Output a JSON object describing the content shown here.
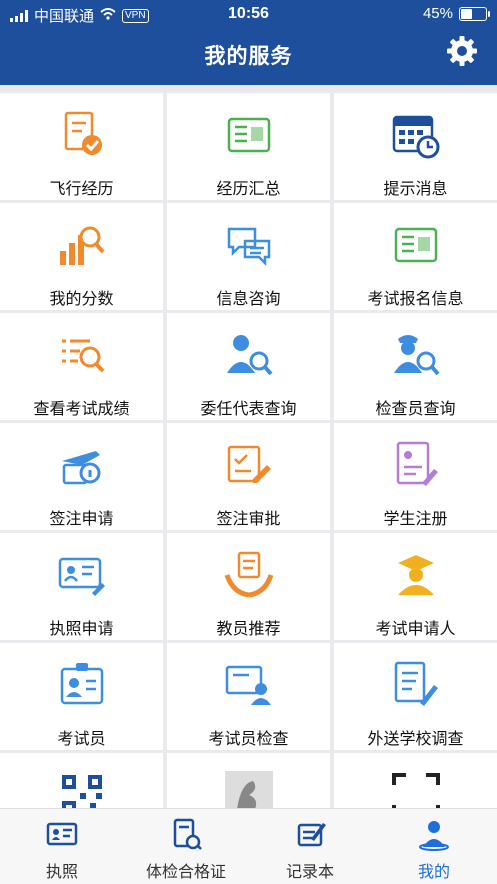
{
  "status_bar": {
    "carrier": "中国联通",
    "vpn": "VPN",
    "time": "10:56",
    "battery": "45%",
    "battery_level": 0.45
  },
  "header": {
    "title": "我的服务",
    "settings_icon": "gear-icon"
  },
  "services": [
    {
      "label": "飞行经历",
      "icon": "document-check-icon",
      "color": "#f08a2c"
    },
    {
      "label": "经历汇总",
      "icon": "newspaper-icon",
      "color": "#4caf50"
    },
    {
      "label": "提示消息",
      "icon": "calendar-clock-icon",
      "color": "#1e4f9c"
    },
    {
      "label": "我的分数",
      "icon": "bar-chart-search-icon",
      "color": "#f08a2c"
    },
    {
      "label": "信息咨询",
      "icon": "chat-bubbles-icon",
      "color": "#3d8ee0"
    },
    {
      "label": "考试报名信息",
      "icon": "newspaper-icon",
      "color": "#4caf50"
    },
    {
      "label": "查看考试成绩",
      "icon": "list-search-icon",
      "color": "#f08a2c"
    },
    {
      "label": "委任代表查询",
      "icon": "person-search-icon",
      "color": "#3d8ee0"
    },
    {
      "label": "检查员查询",
      "icon": "officer-search-icon",
      "color": "#3d8ee0"
    },
    {
      "label": "签注申请",
      "icon": "airplane-info-icon",
      "color": "#3d8ee0"
    },
    {
      "label": "签注审批",
      "icon": "approval-pen-icon",
      "color": "#f08a2c"
    },
    {
      "label": "学生注册",
      "icon": "register-form-icon",
      "color": "#b57cd6"
    },
    {
      "label": "执照申请",
      "icon": "id-card-pen-icon",
      "color": "#3d8ee0"
    },
    {
      "label": "教员推荐",
      "icon": "hands-document-icon",
      "color": "#f08a2c"
    },
    {
      "label": "考试申请人",
      "icon": "graduate-icon",
      "color": "#f0b020"
    },
    {
      "label": "考试员",
      "icon": "badge-person-icon",
      "color": "#3d8ee0"
    },
    {
      "label": "考试员检查",
      "icon": "screen-person-icon",
      "color": "#3d8ee0"
    },
    {
      "label": "外送学校调查",
      "icon": "document-pen-icon",
      "color": "#3d8ee0"
    },
    {
      "label": "",
      "icon": "qr-code-icon",
      "color": "#1e4f9c"
    },
    {
      "label": "",
      "icon": "photo-thumbnail-icon",
      "color": "#999999"
    },
    {
      "label": "",
      "icon": "scan-frame-icon",
      "color": "#222222"
    }
  ],
  "tabbar": [
    {
      "label": "执照",
      "icon": "license-card-icon"
    },
    {
      "label": "体检合格证",
      "icon": "medical-certificate-icon"
    },
    {
      "label": "记录本",
      "icon": "logbook-icon"
    },
    {
      "label": "我的",
      "icon": "user-profile-icon",
      "active": true
    }
  ],
  "colors": {
    "header": "#1e4f9c",
    "active_tab": "#1e6fd9"
  }
}
